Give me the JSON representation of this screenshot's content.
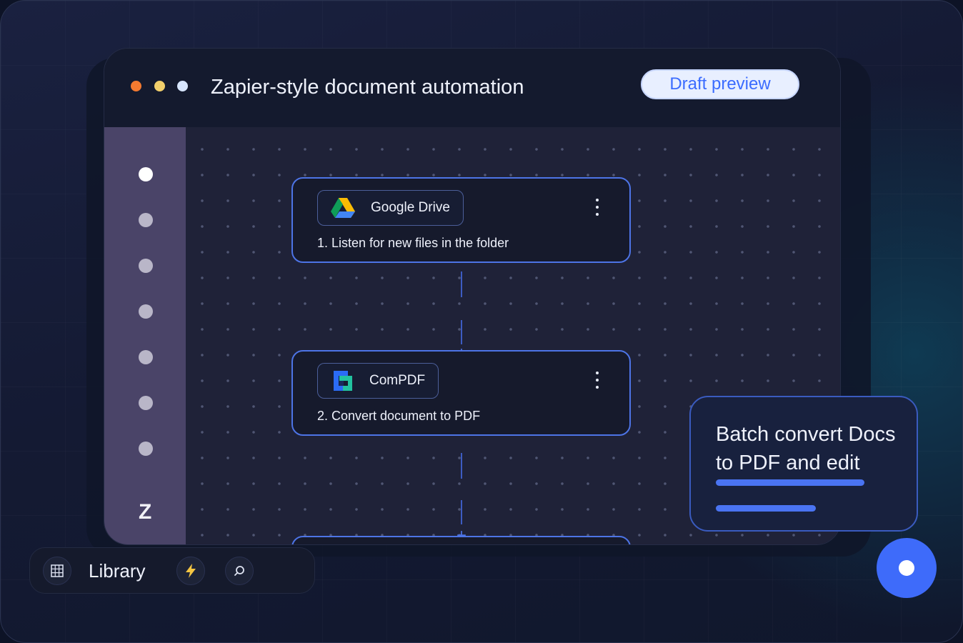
{
  "window": {
    "title": "Zapier-style document automation",
    "badge": "Draft preview"
  },
  "sidebar": {
    "logo": "Z",
    "items": [
      "",
      "",
      "",
      "",
      "",
      "",
      ""
    ]
  },
  "steps": [
    {
      "app": "Google Drive",
      "icon": "google-drive-icon",
      "description": "1. Listen for new files in the folder"
    },
    {
      "app": "ComPDF",
      "icon": "compdf-icon",
      "description": "2. Convert document to PDF"
    }
  ],
  "connector": {
    "symbol": "+"
  },
  "toolbar": {
    "label": "Library",
    "icons": [
      "grid-icon",
      "lightning-icon",
      "search-icon"
    ]
  },
  "info_card": {
    "text": "Batch convert Docs to PDF and edit"
  },
  "colors": {
    "accent": "#3e6bfa",
    "node_border": "#4d74e6",
    "sidebar": "#4a4468",
    "canvas": "#1f2238"
  }
}
